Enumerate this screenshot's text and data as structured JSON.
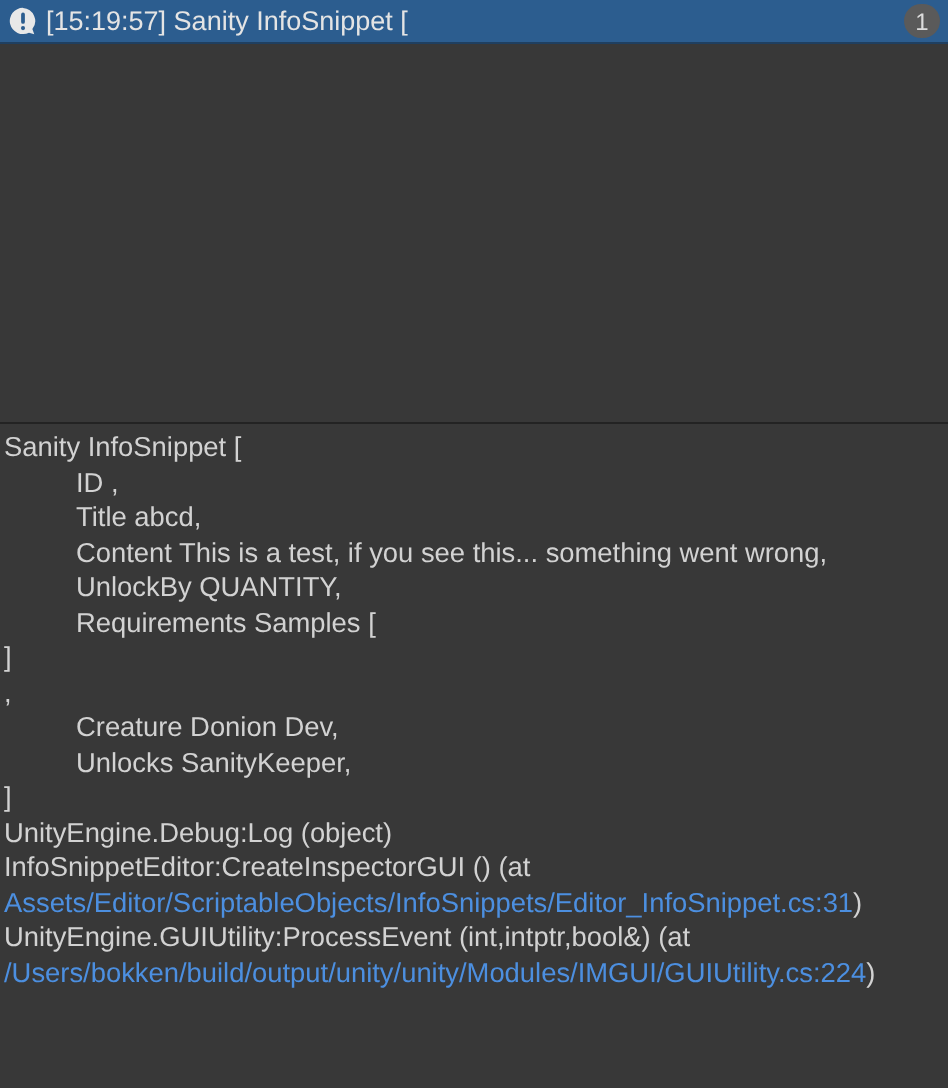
{
  "log_entries": [
    {
      "message": "[15:19:57] Sanity InfoSnippet [",
      "count": "1",
      "selected": true
    }
  ],
  "details": [
    {
      "kind": "text",
      "text": "Sanity InfoSnippet [",
      "indented": false
    },
    {
      "kind": "text",
      "text": "ID ,",
      "indented": true
    },
    {
      "kind": "text",
      "text": "Title abcd,",
      "indented": true
    },
    {
      "kind": "text",
      "text": "Content This is a test, if you see this... something went wrong,",
      "indented": true
    },
    {
      "kind": "text",
      "text": "UnlockBy QUANTITY,",
      "indented": true
    },
    {
      "kind": "text",
      "text": "Requirements Samples [",
      "indented": true
    },
    {
      "kind": "text",
      "text": "]",
      "indented": false
    },
    {
      "kind": "text",
      "text": ",",
      "indented": false
    },
    {
      "kind": "text",
      "text": "Creature Donion Dev,",
      "indented": true
    },
    {
      "kind": "text",
      "text": "Unlocks SanityKeeper,",
      "indented": true
    },
    {
      "kind": "text",
      "text": "]",
      "indented": false
    },
    {
      "kind": "text",
      "text": "UnityEngine.Debug:Log (object)",
      "indented": false
    },
    {
      "kind": "text",
      "text": "InfoSnippetEditor:CreateInspectorGUI () (at",
      "indented": false
    },
    {
      "kind": "link",
      "link": "Assets/Editor/ScriptableObjects/InfoSnippets/Editor_InfoSnippet.cs:31",
      "suffix": ")"
    },
    {
      "kind": "text",
      "text": "UnityEngine.GUIUtility:ProcessEvent (int,intptr,bool&) (at",
      "indented": false
    },
    {
      "kind": "link",
      "link": "/Users/bokken/build/output/unity/unity/Modules/IMGUI/GUIUtility.cs:224",
      "suffix": ")"
    }
  ]
}
